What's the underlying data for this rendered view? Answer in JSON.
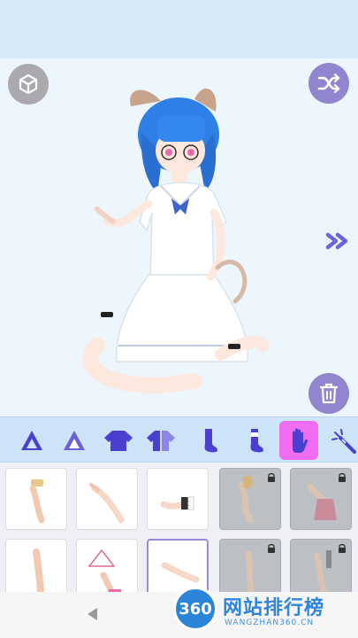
{
  "app": {
    "toolbar": {
      "view_3d_icon": "cube-icon",
      "shuffle_icon": "shuffle-icon",
      "next_icon": "double-chevron-right-icon",
      "trash_icon": "trash-icon"
    },
    "categories": [
      {
        "icon": "hair-front-icon",
        "active": false
      },
      {
        "icon": "hair-back-icon",
        "active": false
      },
      {
        "icon": "top-icon",
        "active": false
      },
      {
        "icon": "jacket-icon",
        "active": false
      },
      {
        "icon": "sock-icon",
        "active": false
      },
      {
        "icon": "stocking-icon",
        "active": false
      },
      {
        "icon": "hand-icon",
        "active": true
      },
      {
        "icon": "wand-icon",
        "active": false
      }
    ],
    "items": [
      {
        "name": "teacup-hand",
        "locked": false,
        "selected": false
      },
      {
        "name": "open-hand",
        "locked": false,
        "selected": false
      },
      {
        "name": "cuffed-hand",
        "locked": false,
        "selected": false
      },
      {
        "name": "bottle-hand",
        "locked": true,
        "selected": false
      },
      {
        "name": "bag-hand",
        "locked": true,
        "selected": false
      },
      {
        "name": "plain-arm",
        "locked": false,
        "selected": false
      },
      {
        "name": "fan-hand",
        "locked": false,
        "selected": false
      },
      {
        "name": "relaxed-hand",
        "locked": false,
        "selected": true
      },
      {
        "name": "pointing-hand",
        "locked": true,
        "selected": false
      },
      {
        "name": "tool-hand",
        "locked": true,
        "selected": false
      }
    ],
    "colors": {
      "accent": "#8f86cf",
      "active_tab": "#f06cf0",
      "stage_bg": "#eef6fd"
    }
  },
  "watermark": {
    "logo_text": "360",
    "title": "网站排行榜",
    "url": "WANGZHAN360.CN"
  }
}
